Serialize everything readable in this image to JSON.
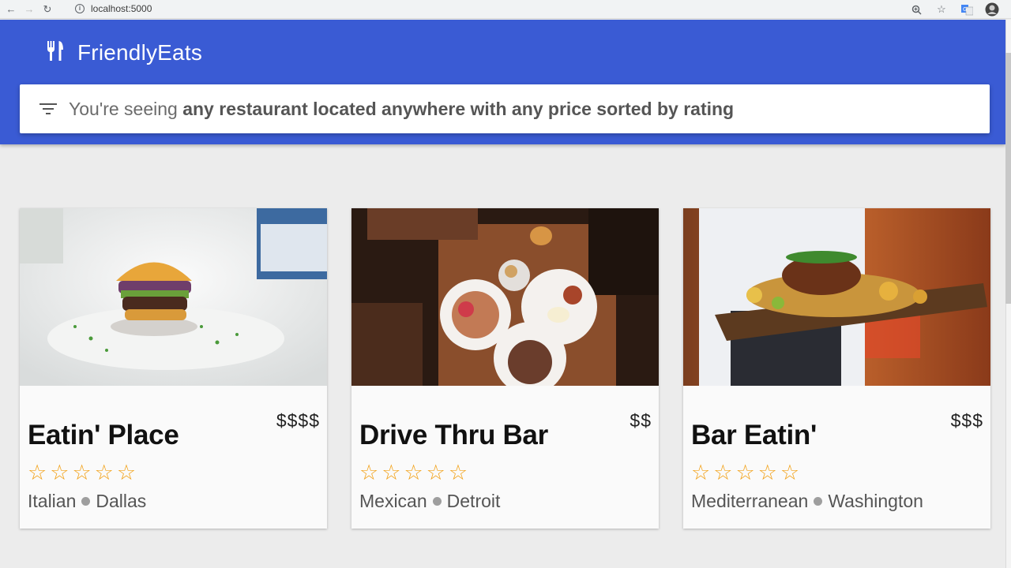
{
  "browser": {
    "url": "localhost:5000"
  },
  "app": {
    "brand": "FriendlyEats",
    "filter": {
      "prefix": "You're seeing ",
      "description": "any restaurant located anywhere with any price sorted by rating"
    }
  },
  "cards": [
    {
      "title": "Eatin' Place",
      "price": "$$$$",
      "rating": 0,
      "max_rating": 5,
      "category": "Italian",
      "city": "Dallas",
      "image": "burger-photo"
    },
    {
      "title": "Drive Thru Bar",
      "price": "$$",
      "rating": 0,
      "max_rating": 5,
      "category": "Mexican",
      "city": "Detroit",
      "image": "table-dishes-photo"
    },
    {
      "title": "Bar Eatin'",
      "price": "$$$",
      "rating": 0,
      "max_rating": 5,
      "category": "Mediterranean",
      "city": "Washington",
      "image": "serving-board-photo"
    }
  ],
  "colors": {
    "header_blue": "#3a5bd4",
    "star_orange": "#f2a117"
  }
}
